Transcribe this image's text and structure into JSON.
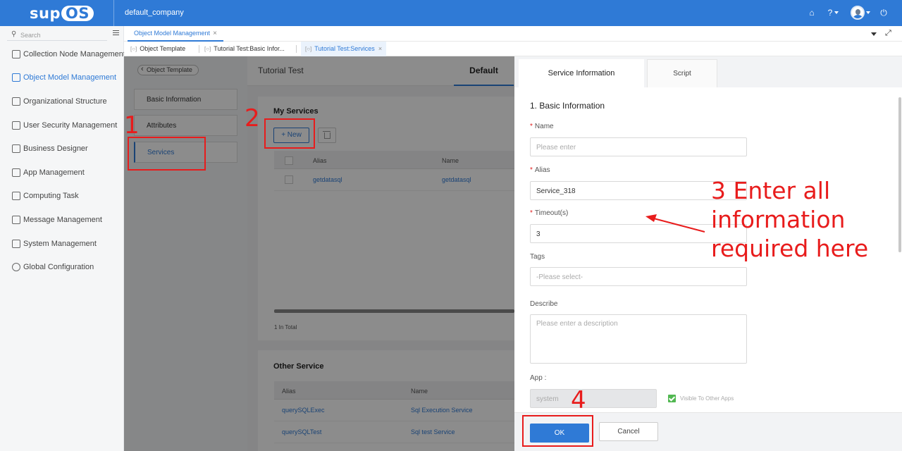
{
  "topbar": {
    "logo_prefix": "sup",
    "logo_suffix": "OS",
    "company": "default_company"
  },
  "sidebar": {
    "search_placeholder": "Search",
    "items": [
      {
        "label": "Collection Node Management"
      },
      {
        "label": "Object Model Management"
      },
      {
        "label": "Organizational Structure"
      },
      {
        "label": "User Security Management"
      },
      {
        "label": "Business Designer"
      },
      {
        "label": "App Management"
      },
      {
        "label": "Computing Task"
      },
      {
        "label": "Message Management"
      },
      {
        "label": "System Management"
      },
      {
        "label": "Global Configuration"
      }
    ]
  },
  "tabs": {
    "main": "Object Model Management",
    "sub": [
      {
        "label": "Object Template"
      },
      {
        "label": "Tutorial Test:Basic Infor..."
      },
      {
        "label": "Tutorial Test:Services"
      }
    ]
  },
  "content": {
    "back_label": "Object Template",
    "subnav": [
      {
        "label": "Basic Information"
      },
      {
        "label": "Attributes"
      },
      {
        "label": "Services"
      }
    ],
    "title": "Tutorial Test",
    "active_tab": "Default",
    "my_services": {
      "title": "My Services",
      "new_label": "+ New",
      "columns": [
        "Alias",
        "Name"
      ],
      "rows": [
        {
          "alias": "getdatasql",
          "name": "getdatasql"
        }
      ],
      "total": "1 In Total"
    },
    "other_service": {
      "title": "Other Service",
      "columns": [
        "Alias",
        "Name"
      ],
      "rows": [
        {
          "alias": "querySQLExec",
          "name": "Sql Execution Service"
        },
        {
          "alias": "querySQLTest",
          "name": "Sql test Service"
        }
      ]
    }
  },
  "drawer": {
    "tabs": [
      "Service Information",
      "Script"
    ],
    "section": "1. Basic Information",
    "name_label": "Name",
    "name_placeholder": "Please enter",
    "alias_label": "Alias",
    "alias_value": "Service_318",
    "timeout_label": "Timeout(s)",
    "timeout_value": "3",
    "tags_label": "Tags",
    "tags_placeholder": "-Please select-",
    "describe_label": "Describe",
    "describe_placeholder": "Please enter a description",
    "app_label": "App :",
    "app_value": "system",
    "visible_label": "Visible To Other Apps",
    "ok_label": "OK",
    "cancel_label": "Cancel"
  },
  "annotations": {
    "step1": "1",
    "step2": "2",
    "step3": "3 Enter all information required here",
    "step4": "4",
    "color": "#e81c1c"
  }
}
